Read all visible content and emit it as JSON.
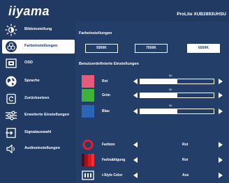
{
  "header": {
    "logo": "iiyama",
    "model": "ProLite XUB2893UHSU"
  },
  "sidebar": {
    "items": [
      {
        "label": "Bildeinstellung",
        "icon": "brightness-icon",
        "active": false
      },
      {
        "label": "Farbeinstellungen",
        "icon": "color-wheel-icon",
        "active": true
      },
      {
        "label": "OSD",
        "icon": "osd-icon",
        "active": false
      },
      {
        "label": "Sprache",
        "icon": "globe-icon",
        "active": false
      },
      {
        "label": "Zurücksetzen",
        "icon": "reset-icon",
        "active": false
      },
      {
        "label": "Erweiterte Einstellungen",
        "icon": "sliders-icon",
        "active": false
      },
      {
        "label": "Signalauswahl",
        "icon": "input-icon",
        "active": false
      },
      {
        "label": "Audioeinstellungen",
        "icon": "speaker-icon",
        "active": false
      }
    ]
  },
  "main": {
    "temperature": {
      "title": "Farbeinstellungen",
      "options": [
        "9300K",
        "7500K",
        "6500K"
      ],
      "selected": "6500K"
    },
    "user_settings": {
      "title": "Benutzerdefinierte Einstellungen",
      "channels": [
        {
          "label": "Rot",
          "value": "50",
          "percent": 50,
          "color": "#e75b7a"
        },
        {
          "label": "Grün",
          "value": "50",
          "percent": 50,
          "color": "#3fb13f"
        },
        {
          "label": "Blau",
          "value": "50",
          "percent": 50,
          "color": "#2a66b5"
        }
      ]
    },
    "color_options": [
      {
        "label": "Farbton",
        "value": "Rot",
        "icon": "hue-ring-icon"
      },
      {
        "label": "Farbsättigung",
        "value": "Rot",
        "icon": "saturation-icon"
      },
      {
        "label": "i-Style Color",
        "value": "Aus",
        "icon": "istyle-icon"
      }
    ]
  },
  "colors": {
    "background": "#203a63",
    "panel": "#233e68",
    "text": "#ffffff"
  }
}
